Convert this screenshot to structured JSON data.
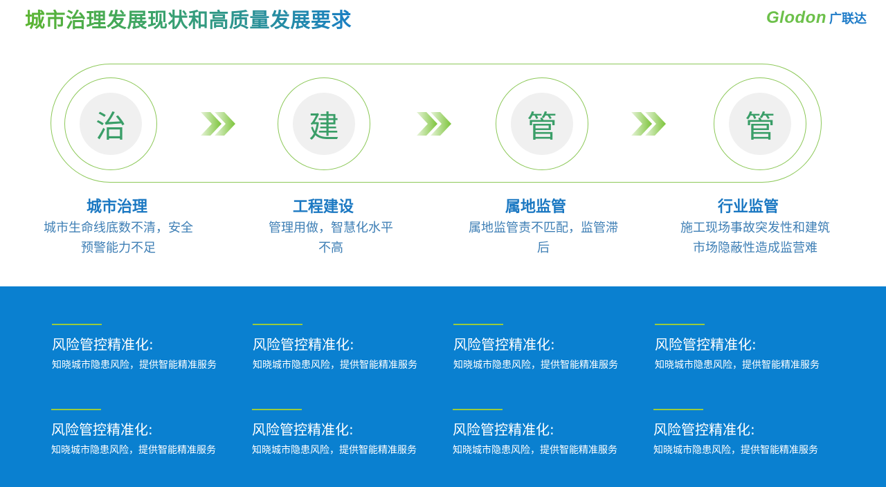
{
  "header": {
    "title": "城市治理发展现状和高质量发展要求",
    "logo_word": "Glodon",
    "logo_cn": "广联达"
  },
  "stages": [
    {
      "glyph": "治",
      "title": "城市治理",
      "desc_line1": "城市生命线底数不清，安全",
      "desc_line2": "预警能力不足"
    },
    {
      "glyph": "建",
      "title": "工程建设",
      "desc_line1": "管理用做，智慧化水平",
      "desc_line2": "不高"
    },
    {
      "glyph": "管",
      "title": "属地监管",
      "desc_line1": "属地监管责不匹配，监管滞",
      "desc_line2": "后"
    },
    {
      "glyph": "管",
      "title": "行业监管",
      "desc_line1": "施工现场事故突发性和建筑",
      "desc_line2": "市场隐蔽性造成监营难"
    }
  ],
  "cards": [
    {
      "title": "风险管控精准化:",
      "text": "知晓城市隐患风险，提供智能精准服务"
    },
    {
      "title": "风险管控精准化:",
      "text": "知晓城市隐患风险，提供智能精准服务"
    },
    {
      "title": "风险管控精准化:",
      "text": "知晓城市隐患风险，提供智能精准服务"
    },
    {
      "title": "风险管控精准化:",
      "text": "知晓城市隐患风险，提供智能精准服务"
    },
    {
      "title": "风险管控精准化:",
      "text": "知晓城市隐患风险，提供智能精准服务"
    },
    {
      "title": "风险管控精准化:",
      "text": "知晓城市隐患风险，提供智能精准服务"
    },
    {
      "title": "风险管控精准化:",
      "text": "知晓城市隐患风险，提供智能精准服务"
    },
    {
      "title": "风险管控精准化:",
      "text": "知晓城市隐患风险，提供智能精准服务"
    }
  ],
  "colors": {
    "accent_green": "#8cc858",
    "brand_blue": "#1b78c2",
    "band_blue": "#0a80d0"
  },
  "icons": [
    "double-chevron-right-icon"
  ]
}
